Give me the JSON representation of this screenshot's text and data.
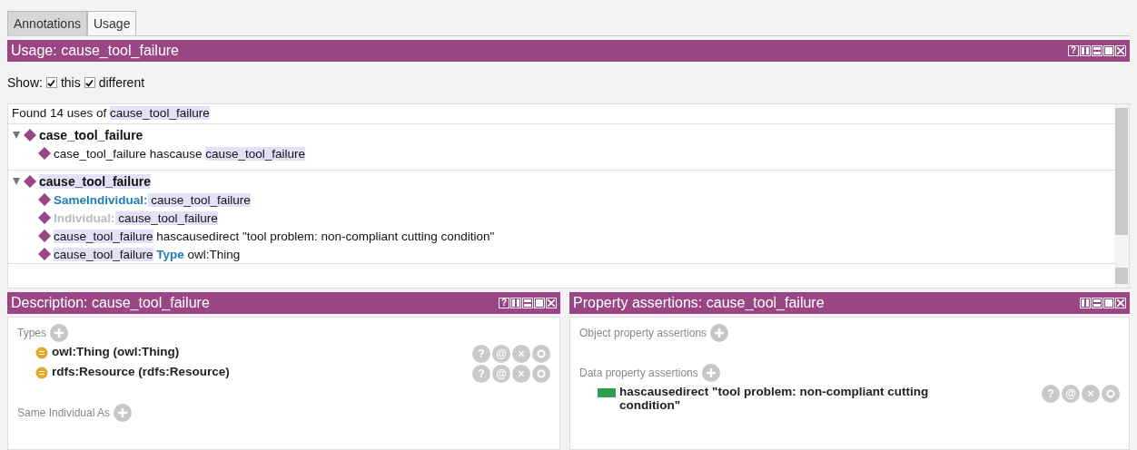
{
  "tabs": [
    {
      "label": "Annotations",
      "selected": false
    },
    {
      "label": "Usage",
      "selected": true
    }
  ],
  "usage": {
    "title": "Usage: cause_tool_failure",
    "controls": [
      {
        "kind": "help",
        "label": "?"
      },
      {
        "kind": "split-v"
      },
      {
        "kind": "split-h"
      },
      {
        "kind": "maximize"
      },
      {
        "kind": "close"
      }
    ],
    "show": {
      "label": "Show:",
      "options": [
        {
          "label": "this",
          "checked": true
        },
        {
          "label": "different",
          "checked": true
        }
      ]
    },
    "found": [
      {
        "text": "Found 14 uses of ",
        "kind": "plain"
      },
      {
        "text": "cause_tool_failure",
        "kind": "entity"
      }
    ],
    "tree": [
      {
        "label": "case_tool_failure",
        "highlighted": false,
        "expanded": true,
        "children": [
          [
            {
              "text": "case_tool_failure hascause ",
              "kind": "plain"
            },
            {
              "text": "cause_tool_failure",
              "kind": "entity"
            }
          ]
        ]
      },
      {
        "label": "cause_tool_failure",
        "highlighted": true,
        "expanded": true,
        "children": [
          [
            {
              "text": " SameIndividual:",
              "kind": "keyword"
            },
            {
              "text": " cause_tool_failure",
              "kind": "entity"
            }
          ],
          [
            {
              "text": "Individual:",
              "kind": "inferred"
            },
            {
              "text": " cause_tool_failure",
              "kind": "entity"
            }
          ],
          [
            {
              "text": "cause_tool_failure",
              "kind": "entity"
            },
            {
              "text": " hascausedirect \"tool problem: non-compliant cutting condition\"",
              "kind": "plain"
            }
          ],
          [
            {
              "text": "cause_tool_failure",
              "kind": "entity"
            },
            {
              "text": " Type",
              "kind": "keyword"
            },
            {
              "text": " owl:Thing",
              "kind": "plain"
            }
          ]
        ]
      }
    ]
  },
  "description": {
    "title": "Description: cause_tool_failure",
    "controls": [
      {
        "kind": "help",
        "label": "?"
      },
      {
        "kind": "split-v"
      },
      {
        "kind": "split-h"
      },
      {
        "kind": "maximize"
      },
      {
        "kind": "close"
      }
    ],
    "sections": [
      {
        "label": "Types",
        "items": [
          {
            "text": "owl:Thing (owl:Thing)",
            "kind": "class",
            "actions": [
              "?",
              "@",
              "×"
            ]
          },
          {
            "text": "rdfs:Resource (rdfs:Resource)",
            "kind": "class",
            "actions": [
              "?",
              "@",
              "×"
            ]
          }
        ]
      },
      {
        "label": "Same Individual As"
      }
    ]
  },
  "properties": {
    "title": "Property assertions: cause_tool_failure",
    "controls": [
      {
        "kind": "split-v"
      },
      {
        "kind": "split-h"
      },
      {
        "kind": "maximize"
      },
      {
        "kind": "close"
      }
    ],
    "sections": [
      {
        "label": "Object property assertions"
      },
      {
        "label": "Data property assertions",
        "items": [
          {
            "text": "hascausedirect  \"tool problem: non-compliant cutting condition\"",
            "kind": "data",
            "actions": [
              "?",
              "@",
              "×"
            ]
          }
        ]
      }
    ]
  }
}
